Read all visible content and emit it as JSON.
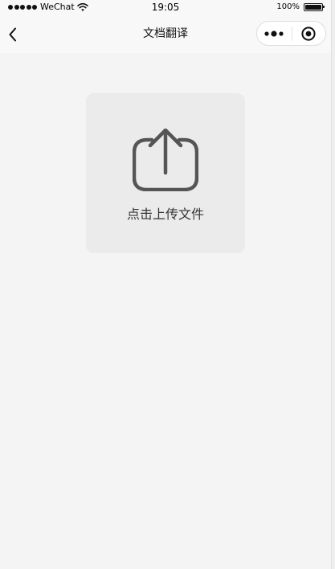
{
  "status_bar": {
    "carrier": "WeChat",
    "time": "19:05",
    "battery": "100%",
    "battery_level": 1.0
  },
  "nav": {
    "title": "文档翻译",
    "back_icon": "chevron-left-icon",
    "more_icon": "more-dots-icon",
    "close_icon": "target-close-icon"
  },
  "upload": {
    "label": "点击上传文件",
    "icon": "share-upload-icon"
  },
  "colors": {
    "background": "#f4f4f4",
    "card": "#ebebeb",
    "icon": "#555555"
  }
}
